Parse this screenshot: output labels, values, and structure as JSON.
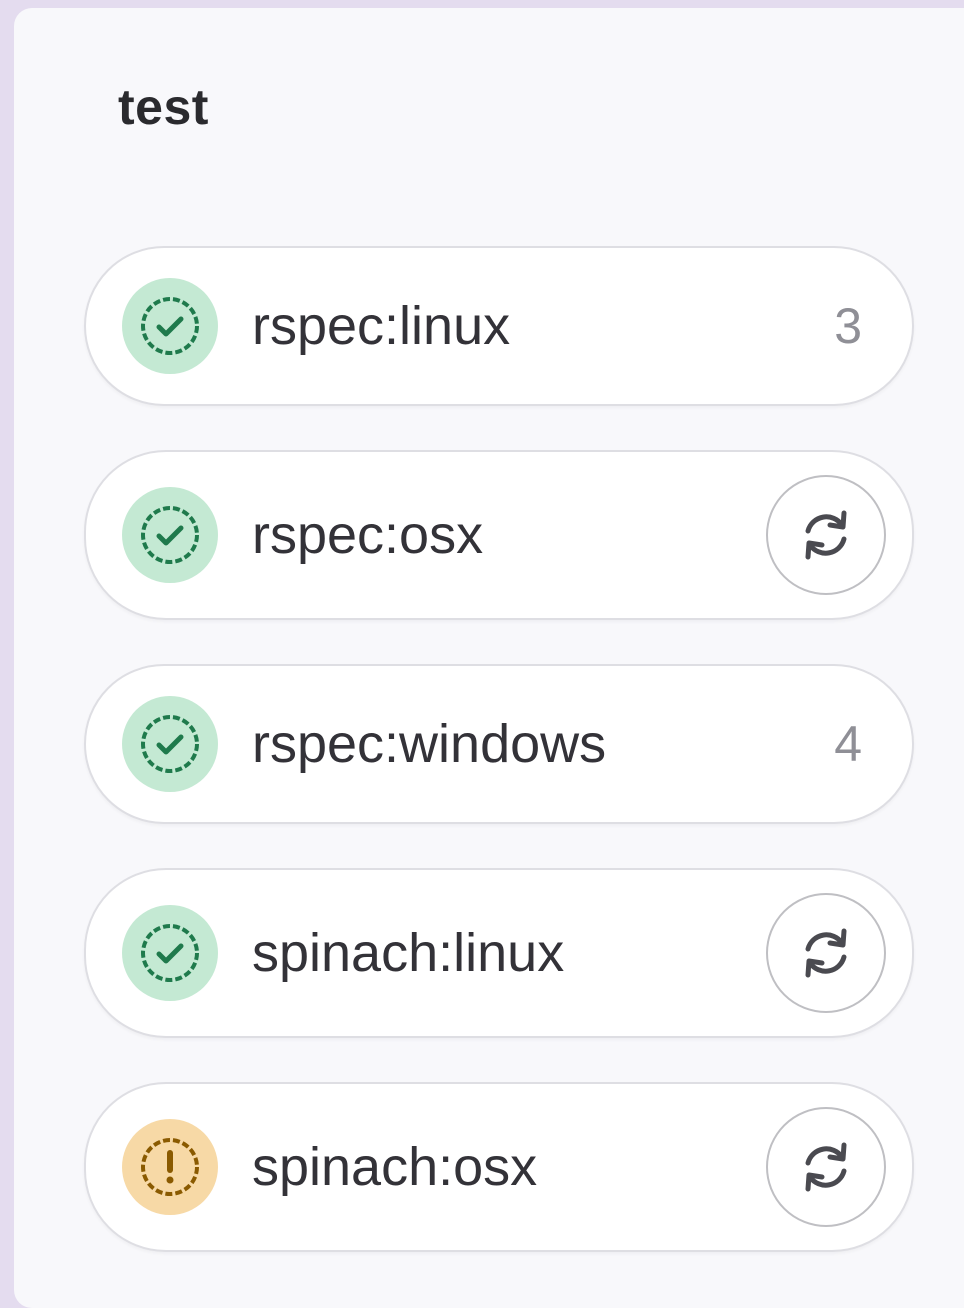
{
  "stage": {
    "title": "test"
  },
  "colors": {
    "success_bg": "#c4e9d3",
    "success_fg": "#1f7a4c",
    "warning_bg": "#f7d9a6",
    "warning_fg": "#8a5a00"
  },
  "jobs": [
    {
      "name": "rspec:linux",
      "status": "success",
      "status_icon": "status-success-icon",
      "count": "3",
      "action": null
    },
    {
      "name": "rspec:osx",
      "status": "success",
      "status_icon": "status-success-icon",
      "count": null,
      "action": "retry"
    },
    {
      "name": "rspec:windows",
      "status": "success",
      "status_icon": "status-success-icon",
      "count": "4",
      "action": null
    },
    {
      "name": "spinach:linux",
      "status": "success",
      "status_icon": "status-success-icon",
      "count": null,
      "action": "retry"
    },
    {
      "name": "spinach:osx",
      "status": "warning",
      "status_icon": "status-warning-icon",
      "count": null,
      "action": "retry"
    }
  ]
}
